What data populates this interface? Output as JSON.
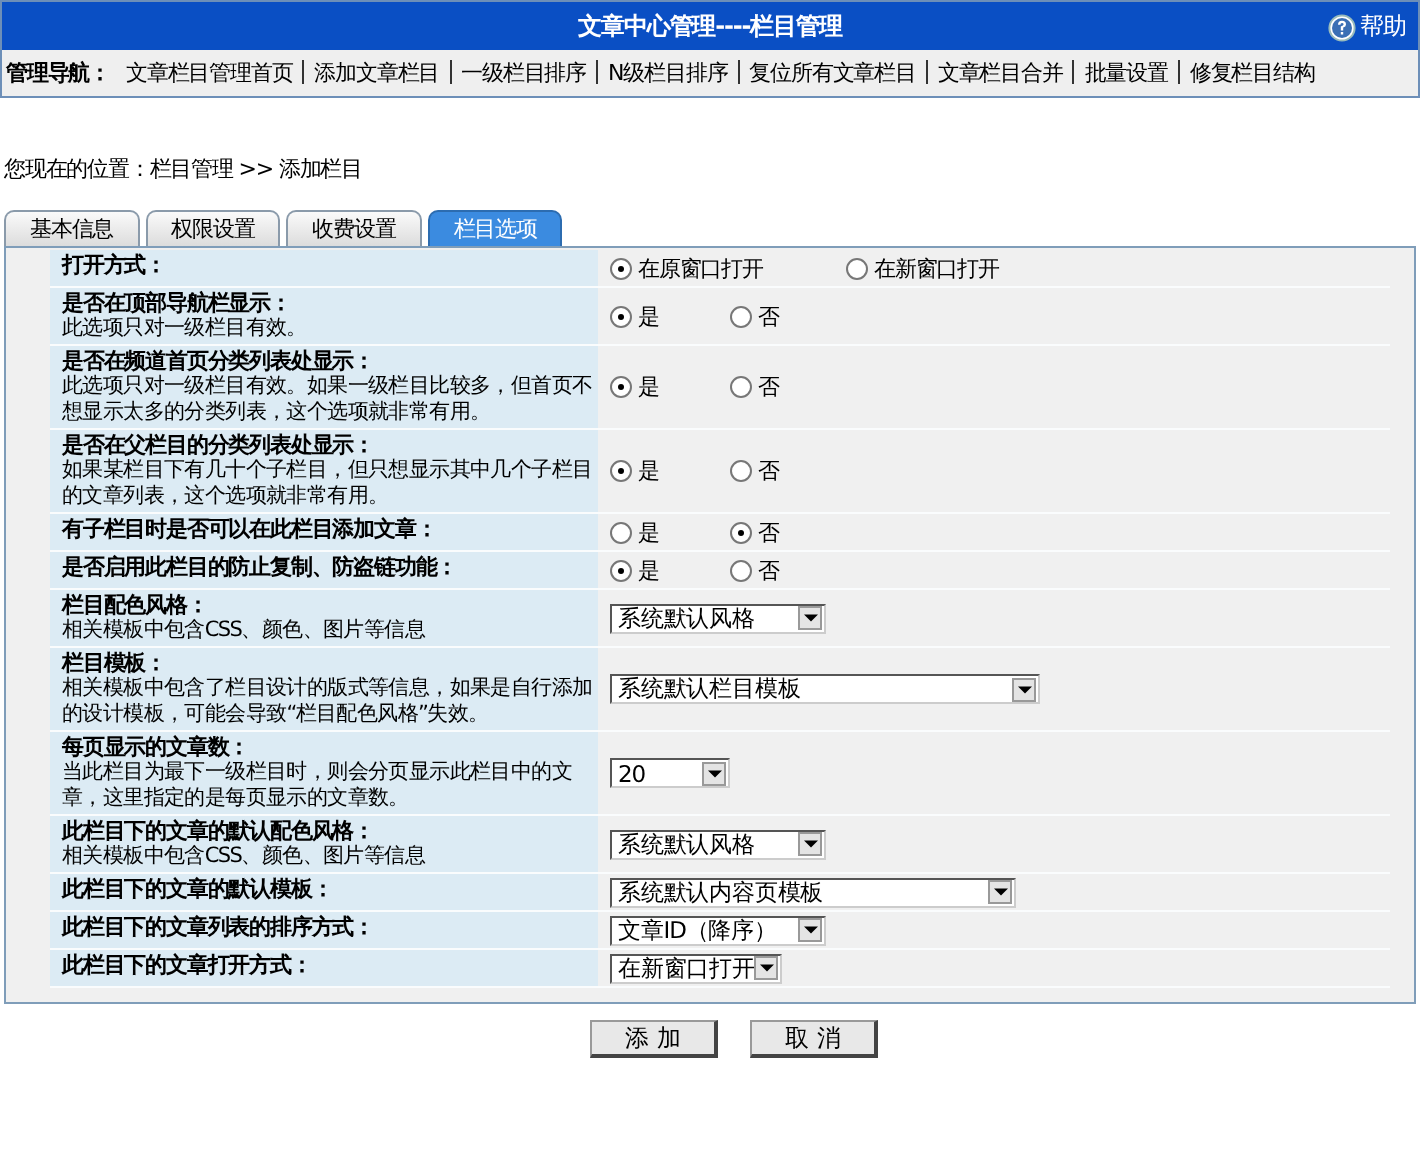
{
  "header": {
    "title": "文章中心管理----栏目管理",
    "help": "帮助"
  },
  "nav": {
    "label": "管理导航：",
    "items": [
      "文章栏目管理首页",
      "添加文章栏目",
      "一级栏目排序",
      "N级栏目排序",
      "复位所有文章栏目",
      "文章栏目合并",
      "批量设置",
      "修复栏目结构"
    ]
  },
  "breadcrumb": "您现在的位置：栏目管理 >> 添加栏目",
  "tabs": [
    {
      "label": "基本信息",
      "selected": false
    },
    {
      "label": "权限设置",
      "selected": false
    },
    {
      "label": "收费设置",
      "selected": false
    },
    {
      "label": "栏目选项",
      "selected": true
    }
  ],
  "rows": [
    {
      "kind": "radio",
      "title": "打开方式：",
      "options": [
        {
          "label": "在原窗口打开",
          "selected": true
        },
        {
          "label": "在新窗口打开",
          "selected": false
        }
      ]
    },
    {
      "kind": "radio",
      "title": "是否在顶部导航栏显示：",
      "note": "此选项只对一级栏目有效。",
      "options": [
        {
          "label": "是",
          "selected": true
        },
        {
          "label": "否",
          "selected": false
        }
      ]
    },
    {
      "kind": "radio",
      "title": "是否在频道首页分类列表处显示：",
      "note": "此选项只对一级栏目有效。如果一级栏目比较多，但首页不想显示太多的分类列表，这个选项就非常有用。",
      "options": [
        {
          "label": "是",
          "selected": true
        },
        {
          "label": "否",
          "selected": false
        }
      ]
    },
    {
      "kind": "radio",
      "title": "是否在父栏目的分类列表处显示：",
      "note": "如果某栏目下有几十个子栏目，但只想显示其中几个子栏目的文章列表，这个选项就非常有用。",
      "options": [
        {
          "label": "是",
          "selected": true
        },
        {
          "label": "否",
          "selected": false
        }
      ]
    },
    {
      "kind": "radio",
      "title": "有子栏目时是否可以在此栏目添加文章：",
      "options": [
        {
          "label": "是",
          "selected": false
        },
        {
          "label": "否",
          "selected": true
        }
      ]
    },
    {
      "kind": "radio",
      "title": "是否启用此栏目的防止复制、防盗链功能：",
      "options": [
        {
          "label": "是",
          "selected": true
        },
        {
          "label": "否",
          "selected": false
        }
      ]
    },
    {
      "kind": "select",
      "title": "栏目配色风格：",
      "note": "相关模板中包含CSS、颜色、图片等信息",
      "value": "系统默认风格"
    },
    {
      "kind": "select",
      "title": "栏目模板：",
      "note": "相关模板中包含了栏目设计的版式等信息，如果是自行添加的设计模板，可能会导致“栏目配色风格”失效。",
      "value": "系统默认栏目模板"
    },
    {
      "kind": "select",
      "title": "每页显示的文章数：",
      "note": "当此栏目为最下一级栏目时，则会分页显示此栏目中的文章，这里指定的是每页显示的文章数。",
      "value": "20"
    },
    {
      "kind": "select",
      "title": "此栏目下的文章的默认配色风格：",
      "note": "相关模板中包含CSS、颜色、图片等信息",
      "value": "系统默认风格"
    },
    {
      "kind": "select",
      "title": "此栏目下的文章的默认模板：",
      "value": "系统默认内容页模板"
    },
    {
      "kind": "select",
      "title": "此栏目下的文章列表的排序方式：",
      "value": "文章ID（降序）"
    },
    {
      "kind": "select",
      "title": "此栏目下的文章打开方式：",
      "value": "在新窗口打开"
    }
  ],
  "buttons": [
    "添 加",
    "取 消"
  ]
}
